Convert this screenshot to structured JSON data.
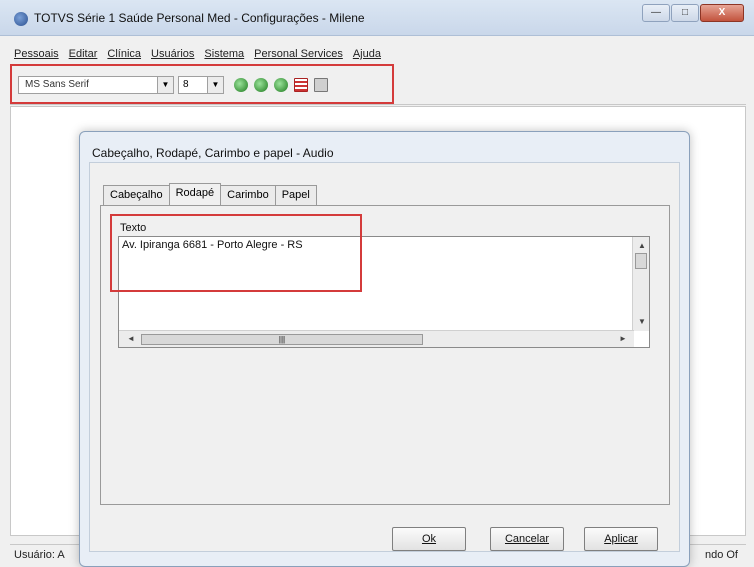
{
  "window": {
    "title": "TOTVS Série 1 Saúde Personal Med - Configurações - Milene",
    "buttons": {
      "minimize": "—",
      "maximize": "□",
      "close": "X"
    }
  },
  "menubar": {
    "items": [
      "Pessoais",
      "Editar",
      "Clínica",
      "Usuários",
      "Sistema",
      "Personal Services",
      "Ajuda"
    ]
  },
  "toolbar": {
    "font_name": "MS Sans Serif",
    "font_size": "8",
    "icons": [
      "green-circle-icon",
      "green-circle-icon",
      "green-circle-icon",
      "grid-icon",
      "document-icon"
    ]
  },
  "statusbar": {
    "left": "Usuário: A",
    "right": "ndo Of"
  },
  "dialog": {
    "title": "Cabeçalho, Rodapé, Carimbo e papel - Audio",
    "tabs": [
      "Cabeçalho",
      "Rodapé",
      "Carimbo",
      "Papel"
    ],
    "active_tab": "Rodapé",
    "group_label": "Texto",
    "text_value": "Av. Ipiranga 6681 - Porto Alegre - RS",
    "buttons": {
      "ok": "Ok",
      "cancel": "Cancelar",
      "apply": "Aplicar"
    }
  },
  "colors": {
    "highlight": "#d43b3b"
  }
}
